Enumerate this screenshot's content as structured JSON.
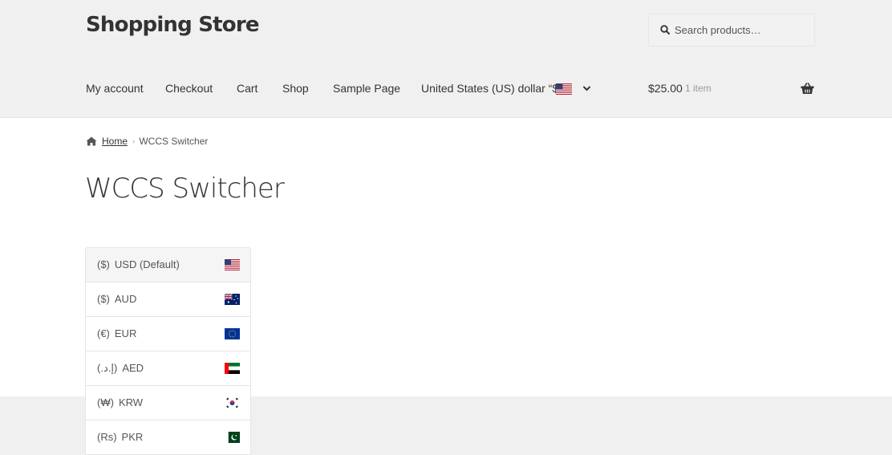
{
  "header": {
    "site_title": "Shopping Store",
    "search": {
      "placeholder": "Search products…"
    }
  },
  "nav": {
    "items": [
      {
        "label": "My account"
      },
      {
        "label": "Checkout"
      },
      {
        "label": "Cart"
      },
      {
        "label": "Shop"
      },
      {
        "label": "Sample Page"
      },
      {
        "label": "United States (US) dollar “$”"
      }
    ]
  },
  "cart": {
    "total": "$25.00",
    "count": "1 item"
  },
  "breadcrumb": {
    "home": "Home",
    "current": "WCCS Switcher"
  },
  "page": {
    "title": "WCCS Switcher"
  },
  "switcher": {
    "items": [
      {
        "symbol": "($)",
        "code": "USD (Default)",
        "flag": "us-flag-icon"
      },
      {
        "symbol": "($)",
        "code": "AUD",
        "flag": "au-flag-icon"
      },
      {
        "symbol": "(€)",
        "code": "EUR",
        "flag": "eu-flag-icon"
      },
      {
        "symbol": "(.إ.د)",
        "code": "AED",
        "flag": "ae-flag-icon"
      },
      {
        "symbol": "(₩)",
        "code": "KRW",
        "flag": "kr-flag-icon"
      },
      {
        "symbol": "(Rs)",
        "code": "PKR",
        "flag": "pk-flag-icon"
      }
    ]
  },
  "colors": {
    "header_bg": "#f0f0f0",
    "text": "#333333",
    "muted": "#999999",
    "active_row": "#f5f5f5"
  }
}
